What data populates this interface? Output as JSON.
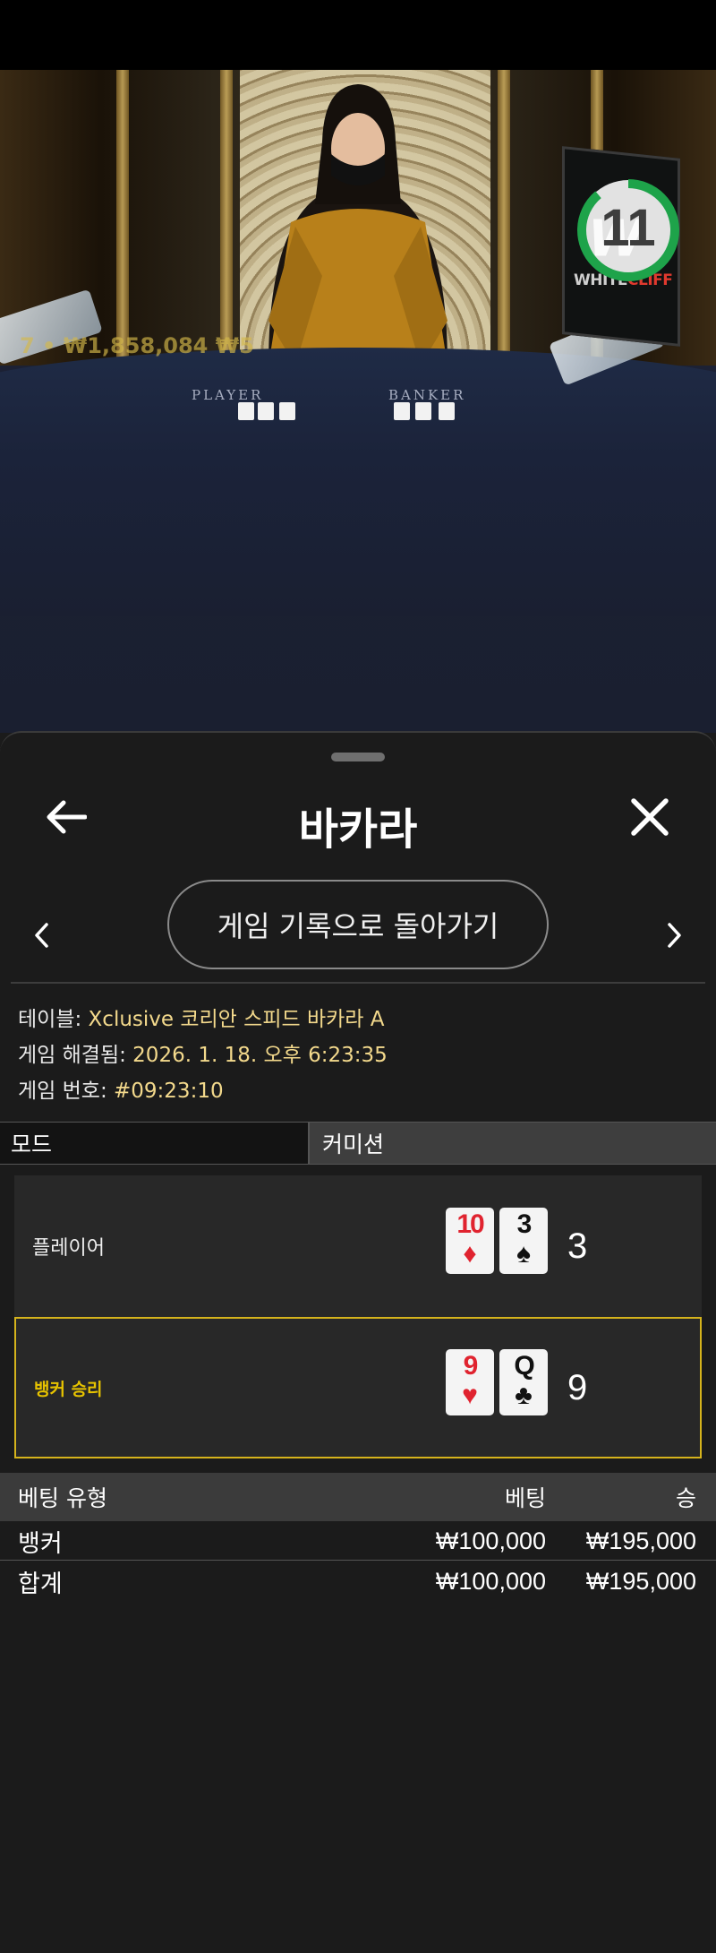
{
  "video": {
    "overlay_amount": "7 • ₩1,858,084 ₩5",
    "table_labels": {
      "player": "PLAYER",
      "banker": "BANKER"
    },
    "logo": {
      "word1": "WHITE",
      "word2": "CLIFF"
    },
    "timer": {
      "value": "11",
      "color": "#1ea34a"
    }
  },
  "header": {
    "title": "바카라",
    "back_icon": "arrow-left-icon",
    "close_icon": "close-icon"
  },
  "history_nav": {
    "button_label": "게임 기록으로 돌아가기",
    "prev_icon": "chevron-left-icon",
    "next_icon": "chevron-right-icon"
  },
  "game_info": {
    "table": {
      "label": "테이블: ",
      "value": "Xclusive 코리안 스피드 바카라 A"
    },
    "resolved": {
      "label": "게임 해결됨: ",
      "value": "2026. 1. 18. 오후 6:23:35"
    },
    "number": {
      "label": "게임 번호: ",
      "value": "#09:23:10"
    }
  },
  "tabs": {
    "mode": "모드",
    "commission": "커미션"
  },
  "results": {
    "player": {
      "label": "플레이어",
      "cards": [
        {
          "rank": "10",
          "suit": "♦"
        },
        {
          "rank": "3",
          "suit": "♠"
        }
      ],
      "score": "3"
    },
    "banker": {
      "label": "뱅커 승리",
      "cards": [
        {
          "rank": "9",
          "suit": "♥"
        },
        {
          "rank": "Q",
          "suit": "♣"
        }
      ],
      "score": "9"
    },
    "winner_color": "#d5b31c"
  },
  "bets": {
    "headers": {
      "type": "베팅 유형",
      "bet": "베팅",
      "win": "승"
    },
    "rows": [
      {
        "type": "뱅커",
        "bet": "₩100,000",
        "win": "₩195,000"
      }
    ],
    "total": {
      "type": "합계",
      "bet": "₩100,000",
      "win": "₩195,000"
    }
  }
}
